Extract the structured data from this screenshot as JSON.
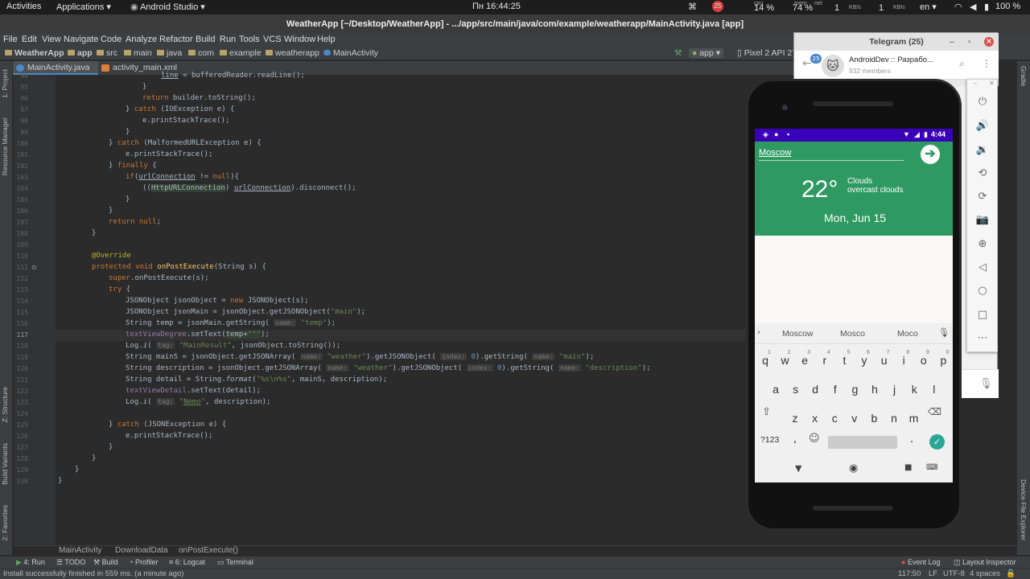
{
  "topbar": {
    "activities": "Activities",
    "applications": "Applications ▾",
    "android_studio": "Android Studio ▾",
    "clock": "Пн 16:44:25",
    "badge": "25",
    "cpu_label": "cpu",
    "cpu": "14 %",
    "mem_label": "mem",
    "mem": "74 %",
    "net_label": "net",
    "net_down": "1",
    "net_unit_down": "KB/s",
    "net_up": "1",
    "net_unit_up": "KB/s",
    "lang": "en ▾",
    "battery": "100 %"
  },
  "window_title": "WeatherApp [~/Desktop/WeatherApp] - .../app/src/main/java/com/example/weatherapp/MainActivity.java [app]",
  "menu": [
    "File",
    "Edit",
    "View",
    "Navigate",
    "Code",
    "Analyze",
    "Refactor",
    "Build",
    "Run",
    "Tools",
    "VCS",
    "Window",
    "Help"
  ],
  "nav": {
    "crumbs": [
      "WeatherApp",
      "app",
      "src",
      "main",
      "java",
      "com",
      "example",
      "weatherapp",
      "MainActivity"
    ],
    "run_config": "app ▾",
    "device": "Pixel 2 API 27"
  },
  "tabs": [
    {
      "label": "MainActivity.java"
    },
    {
      "label": "activity_main.xml"
    }
  ],
  "left_tools": [
    "1: Project",
    "Resource Manager",
    "Z: Structure",
    "Build Variants",
    "2: Favorites"
  ],
  "right_tools": [
    "Gradle",
    "Device File Explorer"
  ],
  "code": {
    "line_numbers": [
      "94",
      "95",
      "96",
      "97",
      "98",
      "99",
      "100",
      "101",
      "102",
      "103",
      "104",
      "105",
      "106",
      "107",
      "108",
      "109",
      "110",
      "111",
      "112",
      "113",
      "114",
      "115",
      "116",
      "117",
      "118",
      "119",
      "120",
      "121",
      "122",
      "123",
      "124",
      "125",
      "126",
      "127",
      "128",
      "129",
      "130"
    ]
  },
  "breadcrumb_bottom": [
    "MainActivity",
    "DownloadData",
    "onPostExecute()"
  ],
  "toolwindows": [
    "4: Run",
    "TODO",
    "Build",
    "Profiler",
    "6: Logcat",
    "Terminal"
  ],
  "toolwindows_right": [
    "Event Log",
    "Layout Inspector"
  ],
  "status": {
    "message": "Install successfully finished in 559 ms. (a minute ago)",
    "position": "117:50",
    "line_sep": "LF",
    "encoding": "UTF-8",
    "indent": "4 spaces"
  },
  "telegram": {
    "title": "Telegram (25)",
    "badge": "25",
    "chat_name": "AndroidDev :: Разрабо...",
    "members": "932 members"
  },
  "phone": {
    "time": "4:44",
    "city": "Moscow",
    "temp": "22°",
    "condition": "Clouds",
    "detail": "overcast clouds",
    "date": "Mon, Jun 15",
    "suggestions": [
      "Moscow",
      "Mosco",
      "Moco"
    ],
    "row1": [
      "q",
      "w",
      "e",
      "r",
      "t",
      "y",
      "u",
      "i",
      "o",
      "p"
    ],
    "row1_hints": [
      "1",
      "2",
      "3",
      "4",
      "5",
      "6",
      "7",
      "8",
      "9",
      "0"
    ],
    "row2": [
      "a",
      "s",
      "d",
      "f",
      "g",
      "h",
      "j",
      "k",
      "l"
    ],
    "row3": [
      "z",
      "x",
      "c",
      "v",
      "b",
      "n",
      "m"
    ],
    "sym_key": "?123",
    "comma": ",",
    "period": "."
  }
}
